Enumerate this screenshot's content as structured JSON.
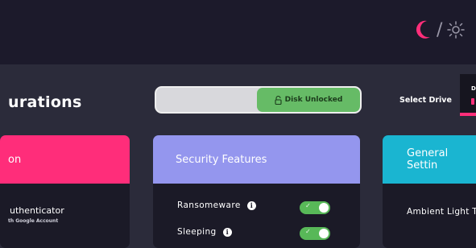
{
  "theme": {
    "moon_color": "#ff2e7a",
    "sun_color": "#9a98a8",
    "separator": "/"
  },
  "page": {
    "section_title": "urations"
  },
  "disk": {
    "status_label": "Disk Unlocked",
    "lock_icon": "unlock-icon",
    "state": "unlocked"
  },
  "drive": {
    "select_label": "Select Drive",
    "current_letter": "D"
  },
  "cards": [
    {
      "title": "on",
      "color": "#ff2d7a"
    },
    {
      "title": "Security Features",
      "color": "#9496ee"
    },
    {
      "title": "General Settin",
      "color": "#1ab5d1"
    }
  ],
  "authenticator": {
    "title": "uthenticator",
    "subtitle": "th Google Account"
  },
  "security_features": [
    {
      "label": "Ransomeware",
      "enabled": true
    },
    {
      "label": "Sleeping",
      "enabled": true
    }
  ],
  "general_settings": [
    {
      "label": "Ambient Light T"
    }
  ]
}
